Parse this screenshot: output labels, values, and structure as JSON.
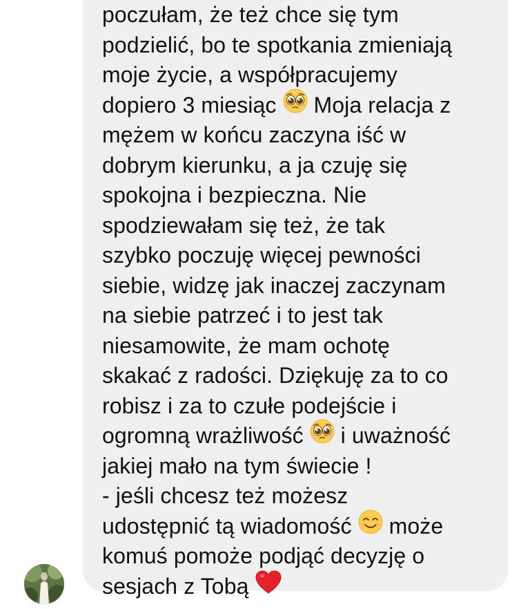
{
  "message": {
    "lines": [
      "poczułam, że też chce się tym",
      "podzielić, bo te spotkania zmieniają",
      "moje życie, a współpracujemy",
      [
        "dopiero 3 miesiąc ",
        " Moja relacja z"
      ],
      "mężem w końcu zaczyna iść w",
      "dobrym kierunku, a ja czuję się",
      "spokojna i bezpieczna. Nie",
      "spodziewałam się też, że tak",
      "szybko poczuję więcej pewności",
      "siebie, widzę jak inaczej zaczynam",
      "na siebie patrzeć i to jest tak",
      "niesamowite, że mam ochotę",
      "skakać z radości. Dziękuję za to co",
      "robisz i za to czułe podejście i",
      [
        "ogromną wrażliwość ",
        " i uważność"
      ],
      "jakiej mało na tym świecie !",
      "- jeśli chcesz też możesz",
      [
        "udostępnić tą wiadomość ",
        "może"
      ],
      "komuś pomoże podjąć decyzję o",
      [
        "sesjach z Tobą ",
        ""
      ]
    ],
    "emojis": {
      "pleading": "pleading-face-icon",
      "smiling": "smiling-face-icon",
      "heart": "red-heart-icon"
    }
  },
  "colors": {
    "bubble": "#efefef",
    "text": "#111111",
    "background": "#ffffff"
  }
}
